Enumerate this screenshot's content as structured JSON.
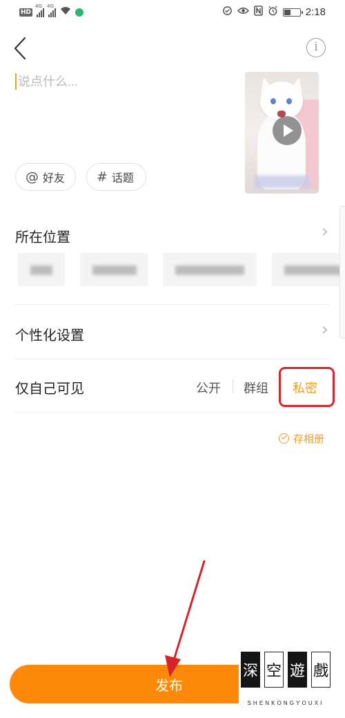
{
  "status_bar": {
    "hd_badge": "HD",
    "network_1": "4G",
    "network_2": "4G",
    "time": "2:18",
    "icons": [
      "signal-icon",
      "wifi-icon",
      "eye-comfort-icon",
      "nfc-icon",
      "alarm-icon",
      "battery-icon"
    ]
  },
  "header": {
    "back_icon": "chevron-left-icon",
    "info_icon": "info-icon",
    "info_glyph": "i"
  },
  "composer": {
    "placeholder": "说点什么..."
  },
  "media": {
    "icon": "play-icon"
  },
  "chips": {
    "friends_symbol": "@",
    "friends_label": "好友",
    "topic_symbol": "#",
    "topic_label": "话题"
  },
  "location": {
    "title": "所在位置",
    "chevron": "›"
  },
  "personalize": {
    "title": "个性化设置",
    "chevron": "›"
  },
  "visibility": {
    "current_label": "仅自己可见",
    "options": [
      "公开",
      "群组",
      "私密"
    ],
    "selected": "私密",
    "accent_color": "#f29a1d"
  },
  "album": {
    "label": "存相册"
  },
  "publish": {
    "label": "发布",
    "color": "#ff8a0a"
  },
  "watermark": {
    "chars": [
      "深",
      "空",
      "遊",
      "戲"
    ],
    "romanized": "SHENKONGYOUXI"
  }
}
